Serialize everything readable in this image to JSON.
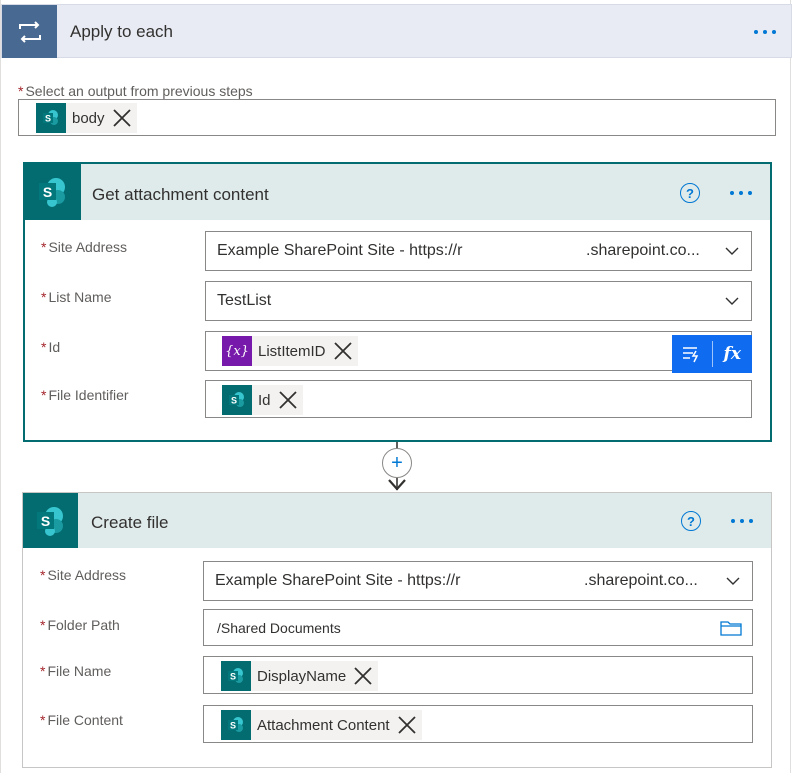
{
  "loop": {
    "title": "Apply to each",
    "select_label": "Select an output from previous steps",
    "select_token": "body"
  },
  "get_attachment": {
    "title": "Get attachment content",
    "fields": {
      "site_address": {
        "label": "Site Address",
        "value_left": "Example SharePoint Site - https://r",
        "value_right": ".sharepoint.co..."
      },
      "list_name": {
        "label": "List Name",
        "value": "TestList"
      },
      "id": {
        "label": "Id",
        "token": "ListItemID"
      },
      "file_identifier": {
        "label": "File Identifier",
        "token": "Id"
      }
    },
    "popup": {
      "fx_label": "fx"
    }
  },
  "create_file": {
    "title": "Create file",
    "fields": {
      "site_address": {
        "label": "Site Address",
        "value_left": "Example SharePoint Site - https://r",
        "value_right": ".sharepoint.co..."
      },
      "folder_path": {
        "label": "Folder Path",
        "value": "/Shared Documents"
      },
      "file_name": {
        "label": "File Name",
        "token": "DisplayName"
      },
      "file_content": {
        "label": "File Content",
        "token": "Attachment Content"
      }
    }
  },
  "required_marker": "*",
  "help_glyph": "?",
  "add_glyph": "+",
  "colors": {
    "loop_header": "#e8ebf3",
    "loop_icon_bg": "#486991",
    "sharepoint": "#036c70",
    "card_header": "#dfeaea",
    "variable_token": "#7719aa",
    "accent": "#0078d4",
    "dynamic_popup": "#0f6cf0"
  },
  "icons": [
    "loop-icon",
    "sharepoint-icon",
    "variable-icon",
    "close-icon",
    "chevron-down-icon",
    "folder-icon",
    "help-icon",
    "more-icon",
    "dynamic-content-icon",
    "expression-icon",
    "add-icon",
    "arrow-down-icon"
  ]
}
